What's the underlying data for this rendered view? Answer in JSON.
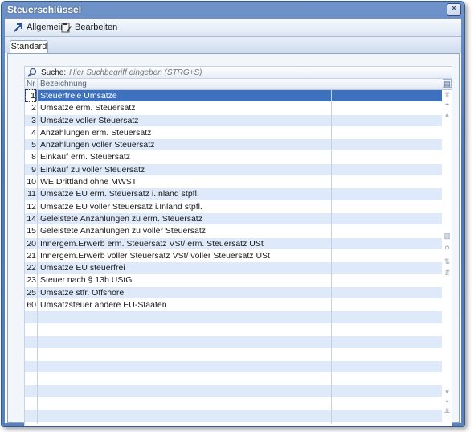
{
  "window": {
    "title": "Steuerschlüssel"
  },
  "toolbar": {
    "allgemein_label": "Allgemein",
    "bearbeiten_label": "Bearbeiten"
  },
  "tabs": {
    "standard_label": "Standard"
  },
  "search": {
    "label": "Suche:",
    "placeholder": "Hier Suchbegriff eingeben (STRG+S)"
  },
  "grid": {
    "columns": {
      "nr": "Nr",
      "bezeichnung": "Bezeichnung"
    },
    "rows": [
      {
        "nr": "1",
        "bezeichnung": "Steuerfreie Umsätze"
      },
      {
        "nr": "2",
        "bezeichnung": "Umsätze erm. Steuersatz"
      },
      {
        "nr": "3",
        "bezeichnung": "Umsätze voller Steuersatz"
      },
      {
        "nr": "4",
        "bezeichnung": "Anzahlungen erm. Steuersatz"
      },
      {
        "nr": "5",
        "bezeichnung": "Anzahlungen voller Steuersatz"
      },
      {
        "nr": "8",
        "bezeichnung": "Einkauf erm. Steuersatz"
      },
      {
        "nr": "9",
        "bezeichnung": "Einkauf zu voller Steuersatz"
      },
      {
        "nr": "10",
        "bezeichnung": "WE Drittland ohne MWST"
      },
      {
        "nr": "11",
        "bezeichnung": "Umsätze EU  erm. Steuersatz i.Inland stpfl."
      },
      {
        "nr": "12",
        "bezeichnung": "Umsätze EU voller Steuersatz i.Inland stpfl."
      },
      {
        "nr": "14",
        "bezeichnung": "Geleistete Anzahlungen zu erm. Steuersatz"
      },
      {
        "nr": "15",
        "bezeichnung": "Geleistete Anzahlungen zu voller Steuersatz"
      },
      {
        "nr": "20",
        "bezeichnung": "Innergem.Erwerb  erm. Steuersatz VSt/ erm. Steuersatz USt"
      },
      {
        "nr": "21",
        "bezeichnung": "Innergem.Erwerb voller Steuersatz VSt/ voller Steuersatz USt"
      },
      {
        "nr": "22",
        "bezeichnung": "Umsätze EU steuerfrei"
      },
      {
        "nr": "23",
        "bezeichnung": "Steuer nach § 13b UStG"
      },
      {
        "nr": "25",
        "bezeichnung": "Umsätze stfr. Offshore"
      },
      {
        "nr": "60",
        "bezeichnung": "Umsatzsteuer andere EU-Staaten"
      }
    ],
    "selected_row": 0
  },
  "colors": {
    "selection": "#3d70bd",
    "alt_row": "#deeafa",
    "title_bar": "#5b81bd"
  }
}
